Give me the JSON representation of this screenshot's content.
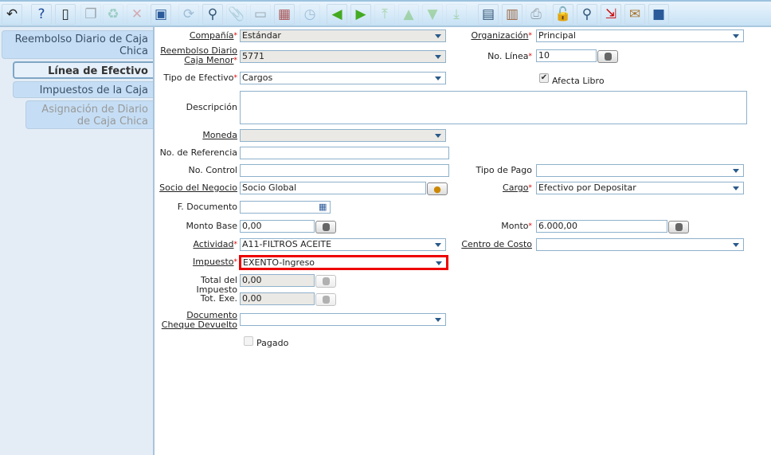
{
  "toolbar": {
    "icons": [
      "undo-icon",
      "help-icon",
      "new-record-icon",
      "copy-icon",
      "delete-icon",
      "cancel-icon",
      "save-icon",
      "refresh-icon",
      "search-icon",
      "attachment-icon",
      "chat-icon",
      "grid-toggle-icon",
      "history-icon",
      "previous-record-icon",
      "next-record-icon",
      "first-record-icon",
      "up-icon",
      "down-icon",
      "last-record-icon",
      "report-icon",
      "archive-icon",
      "print-icon",
      "lock-icon",
      "zoom-across-icon",
      "workflow-icon",
      "request-icon",
      "end-icon"
    ]
  },
  "tabs": [
    {
      "label": "Reembolso Diario de Caja Chica"
    },
    {
      "label": "Línea de Efectivo"
    },
    {
      "label": "Impuestos de la Caja"
    },
    {
      "label": "Asignación de Diario de Caja Chica"
    }
  ],
  "form": {
    "compania": {
      "label": "Compañía",
      "value": "Estándar"
    },
    "organizacion": {
      "label": "Organización",
      "value": "Principal"
    },
    "reembolso": {
      "label": "Reembolso Diario Caja Menor",
      "value": "5771"
    },
    "no_linea": {
      "label": "No. Línea",
      "value": "10"
    },
    "tipo_efectivo": {
      "label": "Tipo de Efectivo",
      "value": "Cargos"
    },
    "afecta_libro": {
      "label": "Afecta Libro",
      "checked": true
    },
    "descripcion": {
      "label": "Descripción",
      "value": ""
    },
    "moneda": {
      "label": "Moneda",
      "value": ""
    },
    "no_referencia": {
      "label": "No. de Referencia",
      "value": ""
    },
    "no_control": {
      "label": "No. Control",
      "value": ""
    },
    "tipo_pago": {
      "label": "Tipo de Pago",
      "value": ""
    },
    "socio": {
      "label": "Socio del Negocio",
      "value": "Socio Global"
    },
    "cargo": {
      "label": "Cargo",
      "value": "Efectivo por Depositar"
    },
    "f_documento": {
      "label": "F. Documento",
      "value": ""
    },
    "monto_base": {
      "label": "Monto Base",
      "value": "0,00"
    },
    "monto": {
      "label": "Monto",
      "value": "6.000,00"
    },
    "actividad": {
      "label": "Actividad",
      "value": "A11-FILTROS ACEITE"
    },
    "centro_costo": {
      "label": "Centro de Costo",
      "value": ""
    },
    "impuesto": {
      "label": "Impuesto",
      "value": "EXENTO-Ingreso"
    },
    "total_impuesto": {
      "label": "Total del Impuesto",
      "value": "0,00"
    },
    "tot_exe": {
      "label": "Tot. Exe.",
      "value": "0,00"
    },
    "doc_cheque": {
      "label": "Documento Cheque Devuelto",
      "value": ""
    },
    "pagado": {
      "label": "Pagado",
      "checked": false
    }
  },
  "required_mark": "*"
}
